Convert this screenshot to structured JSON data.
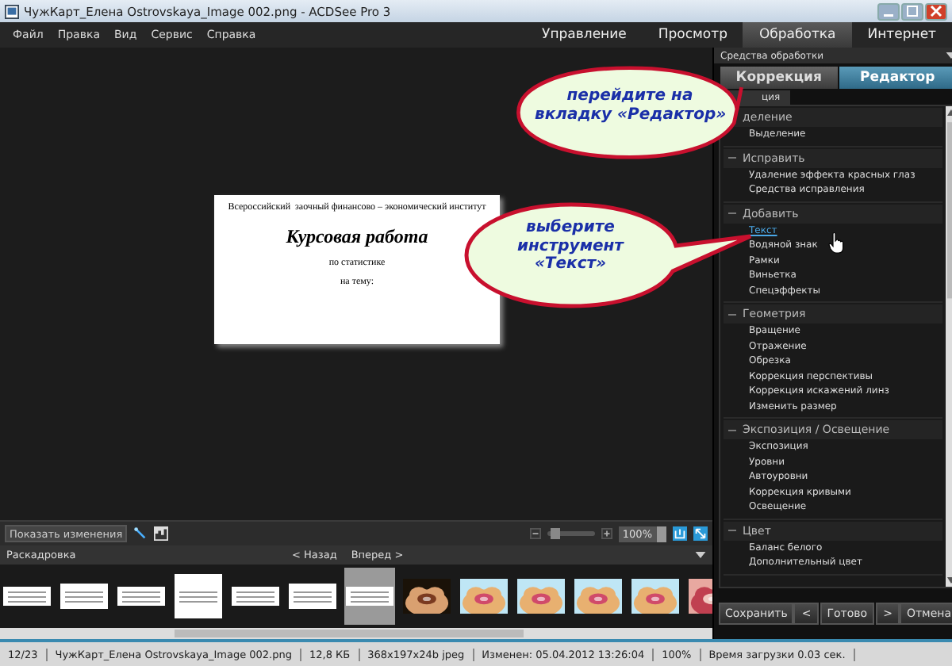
{
  "window": {
    "title": "ЧужКарт_Елена Ostrovskaya_Image 002.png - ACDSee Pro 3"
  },
  "menu": [
    "Файл",
    "Правка",
    "Вид",
    "Сервис",
    "Справка"
  ],
  "mode_tabs": [
    {
      "label": "Управление",
      "selected": false
    },
    {
      "label": "Просмотр",
      "selected": false
    },
    {
      "label": "Обработка",
      "selected": true
    },
    {
      "label": "Интернет",
      "selected": false
    }
  ],
  "document": {
    "header": "Всероссийский  заочный финансово – экономический институт",
    "title": "Курсовая работа",
    "subject": "по статистике",
    "topic": "на тему:"
  },
  "toolbar": {
    "show_changes": "Показать изменения",
    "zoom": {
      "level": 0.15,
      "value": "100%"
    }
  },
  "filmstrip": {
    "title": "Раскадровка",
    "back": "< Назад",
    "forward": "Вперед >",
    "thumbnails": [
      {
        "kind": "document",
        "selected": false
      },
      {
        "kind": "document",
        "selected": false
      },
      {
        "kind": "document",
        "selected": false
      },
      {
        "kind": "document",
        "selected": false
      },
      {
        "kind": "document",
        "selected": false
      },
      {
        "kind": "document",
        "selected": false
      },
      {
        "kind": "document",
        "selected": true
      },
      {
        "kind": "picture",
        "selected": false
      },
      {
        "kind": "picture",
        "selected": false
      },
      {
        "kind": "picture",
        "selected": false
      },
      {
        "kind": "picture",
        "selected": false
      },
      {
        "kind": "picture",
        "selected": false
      },
      {
        "kind": "picture",
        "selected": false
      }
    ]
  },
  "panel": {
    "title": "Средства обработки",
    "tabs": [
      {
        "label": "Коррекция",
        "selected": false
      },
      {
        "label": "Редактор",
        "selected": true
      }
    ],
    "subtab": "ция",
    "sections": [
      {
        "title": "деление",
        "items": [
          {
            "label": "Выделение",
            "selected": false
          }
        ]
      },
      {
        "title": "Исправить",
        "items": [
          {
            "label": "Удаление эффекта красных глаз",
            "selected": false
          },
          {
            "label": "Средства исправления",
            "selected": false
          }
        ]
      },
      {
        "title": "Добавить",
        "items": [
          {
            "label": "Текст",
            "selected": true
          },
          {
            "label": "Водяной знак",
            "selected": false
          },
          {
            "label": "Рамки",
            "selected": false
          },
          {
            "label": "Виньетка",
            "selected": false
          },
          {
            "label": "Спецэффекты",
            "selected": false
          }
        ]
      },
      {
        "title": "Геометрия",
        "items": [
          {
            "label": "Вращение",
            "selected": false
          },
          {
            "label": "Отражение",
            "selected": false
          },
          {
            "label": "Обрезка",
            "selected": false
          },
          {
            "label": "Коррекция перспективы",
            "selected": false
          },
          {
            "label": "Коррекция искажений линз",
            "selected": false
          },
          {
            "label": "Изменить размер",
            "selected": false
          }
        ]
      },
      {
        "title": "Экспозиция / Освещение",
        "items": [
          {
            "label": "Экспозиция",
            "selected": false
          },
          {
            "label": "Уровни",
            "selected": false
          },
          {
            "label": "Автоуровни",
            "selected": false
          },
          {
            "label": "Коррекция кривыми",
            "selected": false
          },
          {
            "label": "Освещение",
            "selected": false
          }
        ]
      },
      {
        "title": "Цвет",
        "items": [
          {
            "label": "Баланс белого",
            "selected": false
          },
          {
            "label": "Дополнительный цвет",
            "selected": false
          }
        ]
      }
    ]
  },
  "buttons": {
    "save": "Сохранить",
    "prev": "<",
    "done": "Готово",
    "next": ">",
    "cancel": "Отмена"
  },
  "status_bar": [
    "12/23",
    "ЧужКарт_Елена Ostrovskaya_Image 002.png",
    "12,8 КБ",
    "368x197x24b jpeg",
    "Изменен: 05.04.2012 13:26:04",
    "100%",
    "Время загрузки 0.03 сек."
  ],
  "callouts": [
    {
      "lines": [
        "перейдите на",
        "вкладку «Редактор»"
      ]
    },
    {
      "lines": [
        "выберите",
        "инструмент",
        "«Текст»"
      ]
    }
  ]
}
